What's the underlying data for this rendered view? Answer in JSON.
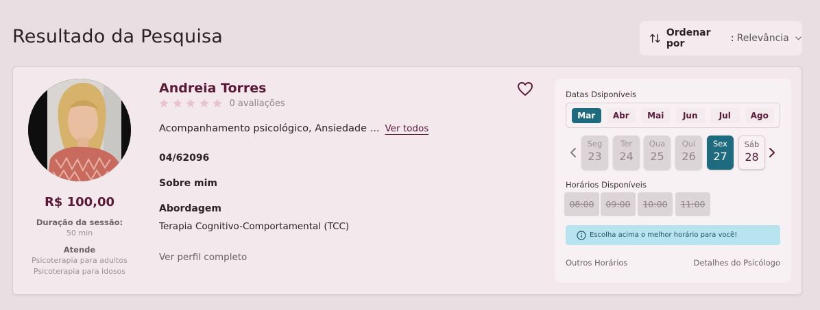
{
  "page": {
    "title": "Resultado da Pesquisa"
  },
  "sort": {
    "label": "Ordenar por",
    "separator": ":",
    "value": "Relevância",
    "icon": "sort-arrows-icon"
  },
  "psychologist": {
    "name": "Andreia Torres",
    "rating": {
      "stars": 0,
      "max_stars": 5,
      "text": "0 avaliações"
    },
    "specialties": "Acompanhamento psicológico, Ansiedade ...",
    "see_all": "Ver todos",
    "crp": "04/62096",
    "about_label": "Sobre mim",
    "approach_label": "Abordagem",
    "approach_value": "Terapia Cognitivo-Comportamental (TCC)",
    "profile_link": "Ver perfil completo",
    "price": "R$ 100,00",
    "duration_label": "Duração da sessão:",
    "duration_value": "50 min",
    "serves_label": "Atende",
    "serves": [
      "Psicoterapia para adultos",
      "Psicoterapia para idosos"
    ]
  },
  "schedule": {
    "dates_title": "Datas Dsiponíveis",
    "months": [
      "Mar",
      "Abr",
      "Mai",
      "Jun",
      "Jul",
      "Ago"
    ],
    "active_month": "Mar",
    "days": [
      {
        "name": "Seg",
        "num": "23",
        "state": "disabled"
      },
      {
        "name": "Ter",
        "num": "24",
        "state": "disabled"
      },
      {
        "name": "Qua",
        "num": "25",
        "state": "disabled"
      },
      {
        "name": "Qui",
        "num": "26",
        "state": "disabled"
      },
      {
        "name": "Sex",
        "num": "27",
        "state": "active"
      },
      {
        "name": "Sáb",
        "num": "28",
        "state": "open"
      }
    ],
    "hours_title": "Horários Disponíveis",
    "hours": [
      "08:00",
      "09:00",
      "10:00",
      "11:00"
    ],
    "info": "Escolha acima o melhor horário para você!",
    "other_hours": "Outros Horários",
    "psychologist_details": "Detalhes do Psicólogo"
  },
  "colors": {
    "brand": "#5b1a38",
    "accent": "#1e6b80",
    "info_bg": "#b8e4ef",
    "background": "#e9dfe2"
  }
}
